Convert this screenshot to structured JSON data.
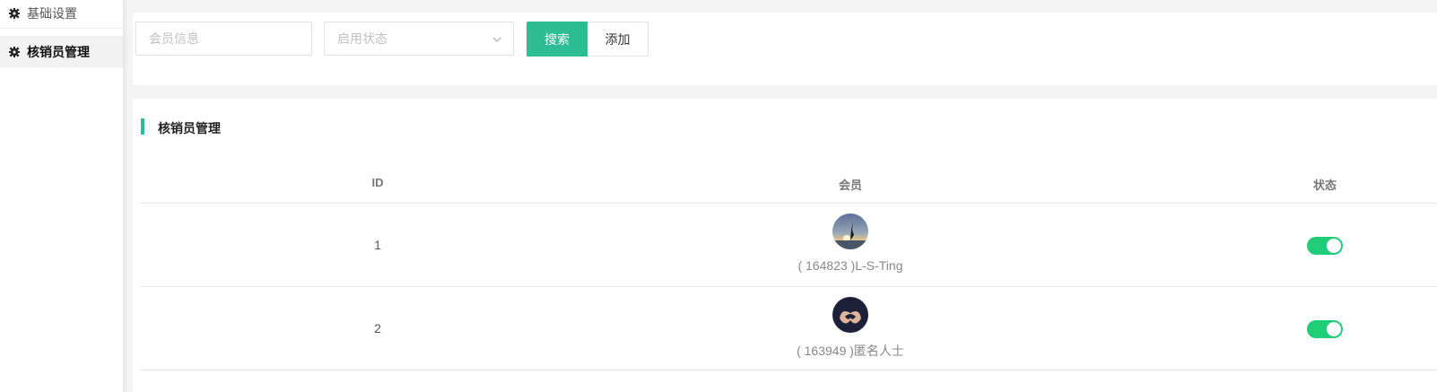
{
  "sidebar": {
    "items": [
      {
        "label": "基础设置",
        "icon": "gear-icon"
      },
      {
        "label": "核销员管理",
        "icon": "gear-icon",
        "active": true
      }
    ]
  },
  "search": {
    "member_placeholder": "会员信息",
    "status_placeholder": "启用状态",
    "search_label": "搜索",
    "add_label": "添加"
  },
  "list": {
    "title": "核销员管理",
    "columns": {
      "id": "ID",
      "member": "会员",
      "status": "状态"
    },
    "rows": [
      {
        "id": "1",
        "member": "( 164823 )L-S-Ting",
        "enabled": true
      },
      {
        "id": "2",
        "member": "( 163949 )匿名人士",
        "enabled": true
      }
    ]
  },
  "colors": {
    "accent": "#2dbd94",
    "toggle_on": "#1fcc78"
  }
}
